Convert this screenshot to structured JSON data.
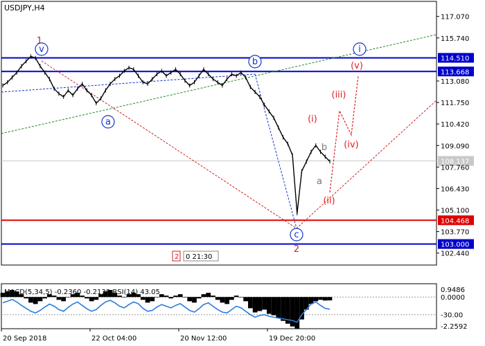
{
  "chart_data": {
    "type": "line",
    "title": "USDJPY,H4",
    "timeframe": "H4",
    "symbol": "USDJPY",
    "ylim": [
      101.7,
      118.0
    ],
    "x_ticks": [
      "20 Sep 2018",
      "22 Oct 04:00",
      "20 Nov 12:00",
      "19 Dec 20:00"
    ],
    "y_ticks": [
      117.07,
      115.74,
      113.08,
      111.75,
      110.42,
      109.09,
      107.76,
      106.43,
      105.1,
      103.77,
      102.44
    ],
    "price_levels": [
      {
        "value": 114.51,
        "label": "114.510",
        "color": "#0000cc"
      },
      {
        "value": 113.668,
        "label": "113.668",
        "color": "#0000cc"
      },
      {
        "value": 104.468,
        "label": "104.468",
        "color": "#e00000"
      },
      {
        "value": 103.0,
        "label": "103.000",
        "color": "#0000cc"
      }
    ],
    "current_price": {
      "value": 108.137,
      "label": "108.137"
    },
    "series": [
      {
        "values": [
          112.8,
          113.0,
          113.3,
          113.6,
          114.0,
          114.3,
          114.6,
          114.5,
          114.0,
          113.6,
          113.2,
          112.6,
          112.3,
          112.1,
          112.5,
          112.2,
          112.6,
          112.9,
          112.5,
          112.2,
          111.7,
          112.0,
          112.5,
          112.9,
          113.2,
          113.4,
          113.7,
          113.9,
          113.8,
          113.4,
          113.0,
          112.9,
          113.2,
          113.5,
          113.7,
          113.4,
          113.6,
          113.8,
          113.5,
          113.1,
          112.8,
          113.0,
          113.4,
          113.8,
          113.5,
          113.2,
          113.0,
          112.8,
          113.2,
          113.5,
          113.4,
          113.6,
          113.3,
          112.7,
          112.4,
          112.1,
          111.6,
          111.2,
          110.8,
          110.2,
          109.6,
          109.2,
          108.5,
          104.9,
          107.5,
          108.1,
          108.7,
          109.1,
          108.7,
          108.4,
          108.1
        ],
        "color": "#000000"
      }
    ],
    "wave_labels": [
      {
        "text": "1",
        "color": "#cc2222"
      },
      {
        "text": "v",
        "color": "#1133cc"
      },
      {
        "text": "a",
        "color": "#1133cc"
      },
      {
        "text": "b",
        "color": "#1133cc"
      },
      {
        "text": "c",
        "color": "#1133cc"
      },
      {
        "text": "2",
        "color": "#cc2222"
      },
      {
        "text": "i",
        "color": "#1133cc"
      },
      {
        "text": "(i)",
        "color": "#e02020"
      },
      {
        "text": "(ii)",
        "color": "#e02020"
      },
      {
        "text": "(iii)",
        "color": "#e02020"
      },
      {
        "text": "(iv)",
        "color": "#e02020"
      },
      {
        "text": "(v)",
        "color": "#e02020"
      },
      {
        "text": "a",
        "color": "#777777"
      },
      {
        "text": "b",
        "color": "#777777"
      }
    ],
    "period_box": {
      "left": "2",
      "right": "0 21:30"
    },
    "indicator": {
      "title": "MACD(5,34,5) -0.2360 -0.2138 RSI(14) 43.05",
      "y_ticks": [
        "0.9486",
        "0.0000",
        "-30.00",
        "-2.2592"
      ],
      "histogram": [
        0.3,
        0.4,
        0.5,
        0.4,
        0.2,
        -0.1,
        -0.4,
        -0.5,
        -0.3,
        -0.1,
        0.2,
        0.1,
        -0.2,
        -0.3,
        0.0,
        0.2,
        0.3,
        0.1,
        -0.1,
        -0.3,
        -0.2,
        0.2,
        0.4,
        0.5,
        0.3,
        0.1,
        0.0,
        0.2,
        0.3,
        0.2,
        -0.2,
        -0.4,
        -0.3,
        0.0,
        0.2,
        0.1,
        -0.1,
        0.1,
        0.2,
        0.0,
        -0.3,
        -0.4,
        -0.1,
        0.2,
        0.3,
        0.1,
        -0.2,
        -0.4,
        -0.5,
        -0.2,
        0.1,
        0.0,
        -0.3,
        -0.8,
        -1.1,
        -1.0,
        -0.9,
        -1.2,
        -1.3,
        -1.5,
        -1.7,
        -1.9,
        -2.1,
        -2.26,
        -1.6,
        -0.9,
        -0.5,
        -0.3,
        -0.2,
        -0.25,
        -0.24
      ],
      "rsi": [
        58,
        62,
        66,
        60,
        52,
        45,
        38,
        34,
        40,
        48,
        55,
        50,
        42,
        38,
        47,
        55,
        60,
        52,
        44,
        38,
        42,
        52,
        60,
        64,
        58,
        50,
        46,
        54,
        60,
        56,
        45,
        38,
        40,
        48,
        54,
        50,
        46,
        52,
        56,
        48,
        40,
        36,
        44,
        54,
        58,
        50,
        42,
        36,
        34,
        42,
        50,
        46,
        38,
        30,
        24,
        28,
        30,
        26,
        24,
        22,
        20,
        18,
        16,
        12,
        30,
        42,
        55,
        60,
        52,
        45,
        43
      ]
    }
  }
}
